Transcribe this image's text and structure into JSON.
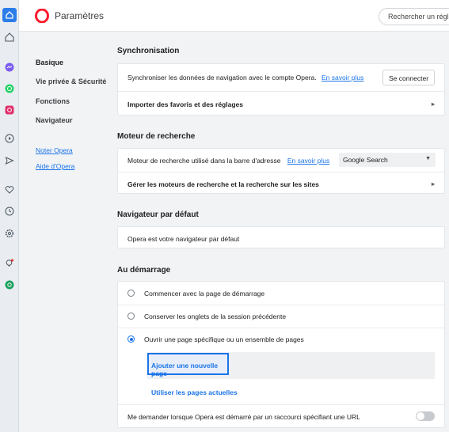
{
  "header": {
    "title": "Paramètres",
    "search_placeholder": "Rechercher un réglage"
  },
  "sidebar": {
    "icons": [
      "home-icon",
      "speed-dial-icon",
      "messenger-icon",
      "whatsapp-icon",
      "instagram-icon",
      "player-icon",
      "send-icon",
      "heart-icon",
      "history-icon",
      "settings-icon",
      "lightbulb-icon",
      "vpn-icon"
    ]
  },
  "nav": {
    "items": [
      "Basique",
      "Vie privée & Sécurité",
      "Fonctions",
      "Navigateur"
    ],
    "links": [
      "Noter Opera",
      "Aide d'Opera"
    ]
  },
  "sync": {
    "title": "Synchronisation",
    "row1_text": "Synchroniser les données de navigation avec le compte Opera.",
    "row1_link": "En savoir plus",
    "connect_button": "Se connecter",
    "row2_text": "Importer des favoris et des réglages"
  },
  "search_engine": {
    "title": "Moteur de recherche",
    "row1_text": "Moteur de recherche utilisé dans la barre d'adresse",
    "row1_link": "En savoir plus",
    "selected": "Google Search",
    "row2_text": "Gérer les moteurs de recherche et la recherche sur les sites"
  },
  "default_browser": {
    "title": "Navigateur par défaut",
    "text": "Opera est votre navigateur par défaut"
  },
  "startup": {
    "title": "Au démarrage",
    "options": [
      "Commencer avec la page de démarrage",
      "Conserver les onglets de la session précédente",
      "Ouvrir une page spécifique ou un ensemble de pages"
    ],
    "selected_index": 2,
    "add_page": "Ajouter une nouvelle page",
    "use_current": "Utiliser les pages actuelles",
    "ask_text": "Me demander lorsque Opera est démarré par un raccourci spécifiant une URL",
    "ask_enabled": false
  },
  "colors": {
    "accent": "#1a73e8",
    "opera_red": "#ff1b2d"
  }
}
